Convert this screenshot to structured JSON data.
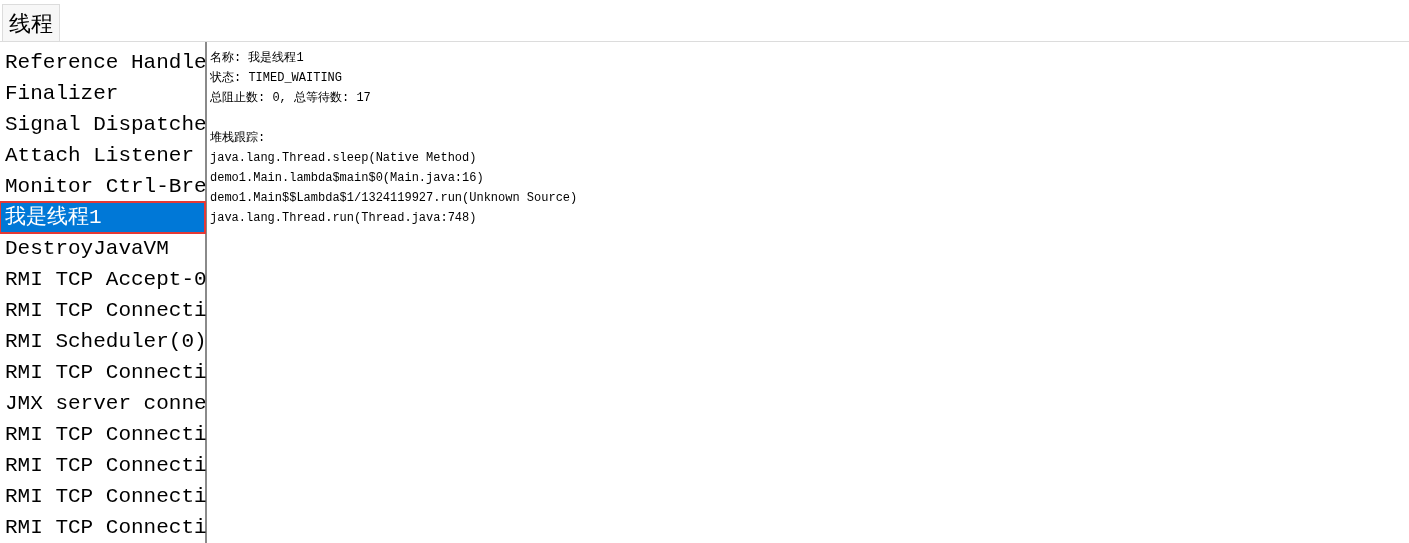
{
  "tabs": [
    {
      "label": "线程",
      "selected": true
    }
  ],
  "threads": [
    {
      "name": "Reference Handle",
      "selected": false
    },
    {
      "name": "Finalizer",
      "selected": false
    },
    {
      "name": "Signal Dispatche",
      "selected": false
    },
    {
      "name": "Attach Listener",
      "selected": false
    },
    {
      "name": "Monitor Ctrl-Bre",
      "selected": false
    },
    {
      "name": "我是线程1",
      "selected": true
    },
    {
      "name": "DestroyJavaVM",
      "selected": false
    },
    {
      "name": "RMI TCP Accept-0",
      "selected": false
    },
    {
      "name": "RMI TCP Connecti",
      "selected": false
    },
    {
      "name": "RMI Scheduler(0)",
      "selected": false
    },
    {
      "name": "RMI TCP Connecti",
      "selected": false
    },
    {
      "name": "JMX server conne",
      "selected": false
    },
    {
      "name": "RMI TCP Connecti",
      "selected": false
    },
    {
      "name": "RMI TCP Connecti",
      "selected": false
    },
    {
      "name": "RMI TCP Connecti",
      "selected": false
    },
    {
      "name": "RMI TCP Connecti",
      "selected": false
    }
  ],
  "details": {
    "lines": [
      "名称: 我是线程1",
      "状态: TIMED_WAITING",
      "总阻止数: 0, 总等待数: 17"
    ],
    "stack_title": "堆栈跟踪:",
    "stack": [
      "java.lang.Thread.sleep(Native Method)",
      "demo1.Main.lambda$main$0(Main.java:16)",
      "demo1.Main$$Lambda$1/1324119927.run(Unknown Source)",
      "java.lang.Thread.run(Thread.java:748)"
    ]
  }
}
